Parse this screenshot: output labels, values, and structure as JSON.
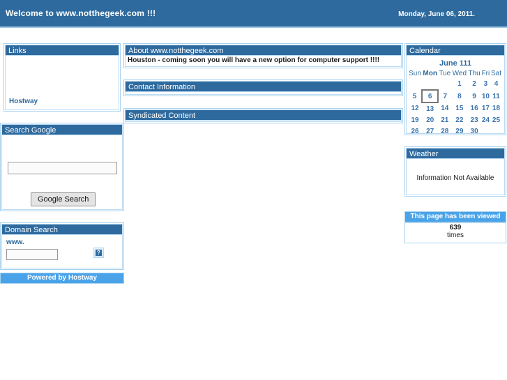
{
  "banner": {
    "welcome": "Welcome to www.notthegeek.com !!!",
    "date": "Monday, June 06, 2011."
  },
  "left": {
    "links": {
      "title": "Links",
      "items": [
        {
          "label": "Hostway"
        }
      ]
    },
    "google": {
      "title": "Search Google",
      "input_value": "",
      "input_placeholder": "",
      "button_label": "Google Search"
    },
    "domain": {
      "title": "Domain Search",
      "prefix_label": "www.",
      "input_value": "",
      "input_placeholder": "",
      "submit_icon": "broken-image-icon",
      "submit_glyph": "?"
    },
    "footer_label": "Powered by Hostway"
  },
  "center": {
    "about": {
      "title": "About www.notthegeek.com",
      "body": "Houston - coming soon you will have a new option for computer support !!!!"
    },
    "contact": {
      "title": "Contact Information",
      "body": ""
    },
    "syndicated": {
      "title": "Syndicated Content",
      "body": ""
    }
  },
  "right": {
    "calendar": {
      "title": "Calendar",
      "month_label": "June 111",
      "daynames": [
        "Sun",
        "Mon",
        "Tue",
        "Wed",
        "Thu",
        "Fri",
        "Sat"
      ],
      "today_dayname": "Mon",
      "today": 6,
      "weeks": [
        [
          "",
          "",
          "",
          "1",
          "2",
          "3",
          "4"
        ],
        [
          "5",
          "6",
          "7",
          "8",
          "9",
          "10",
          "11"
        ],
        [
          "12",
          "13",
          "14",
          "15",
          "16",
          "17",
          "18"
        ],
        [
          "19",
          "20",
          "21",
          "22",
          "23",
          "24",
          "25"
        ],
        [
          "26",
          "27",
          "28",
          "29",
          "30",
          "",
          ""
        ]
      ]
    },
    "weather": {
      "title": "Weather",
      "message": "Information Not Available"
    },
    "counter": {
      "bar_label": "This page has been viewed",
      "count": "639",
      "unit": "times"
    }
  },
  "colors": {
    "header_blue": "#2e6a9e",
    "light_blue": "#4aa3e8",
    "border_blue": "#a7d2f0",
    "link_blue": "#2e6a9e"
  }
}
